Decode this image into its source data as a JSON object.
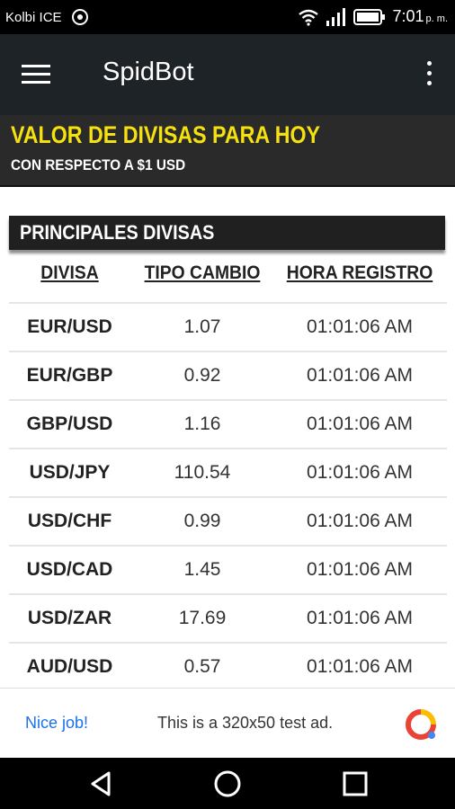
{
  "status_bar": {
    "carrier": "Kolbi ICE",
    "time": "7:01",
    "ampm": "p. m."
  },
  "app_bar": {
    "title": "SpidBot"
  },
  "banner": {
    "title": "VALOR DE DIVISAS PARA HOY",
    "subtitle": "CON RESPECTO A $1 USD"
  },
  "section": {
    "title": "PRINCIPALES DIVISAS"
  },
  "table": {
    "columns": [
      "DIVISA",
      "TIPO CAMBIO",
      "HORA REGISTRO"
    ],
    "rows": [
      {
        "pair": "EUR/USD",
        "rate": "1.07",
        "time": "01:01:06 AM"
      },
      {
        "pair": "EUR/GBP",
        "rate": "0.92",
        "time": "01:01:06 AM"
      },
      {
        "pair": "GBP/USD",
        "rate": "1.16",
        "time": "01:01:06 AM"
      },
      {
        "pair": "USD/JPY",
        "rate": "110.54",
        "time": "01:01:06 AM"
      },
      {
        "pair": "USD/CHF",
        "rate": "0.99",
        "time": "01:01:06 AM"
      },
      {
        "pair": "USD/CAD",
        "rate": "1.45",
        "time": "01:01:06 AM"
      },
      {
        "pair": "USD/ZAR",
        "rate": "17.69",
        "time": "01:01:06 AM"
      },
      {
        "pair": "AUD/USD",
        "rate": "0.57",
        "time": "01:01:06 AM"
      }
    ]
  },
  "ad": {
    "nice": "Nice job!",
    "text": "This is a 320x50 test ad."
  },
  "colors": {
    "banner_title": "#f5e10f",
    "app_bar": "#1e2328",
    "ad_link": "#1a73e8"
  },
  "icons": [
    "menu-icon",
    "more-vert-icon",
    "wifi-icon",
    "signal-icon",
    "battery-icon",
    "back-icon",
    "home-icon",
    "recents-icon"
  ]
}
